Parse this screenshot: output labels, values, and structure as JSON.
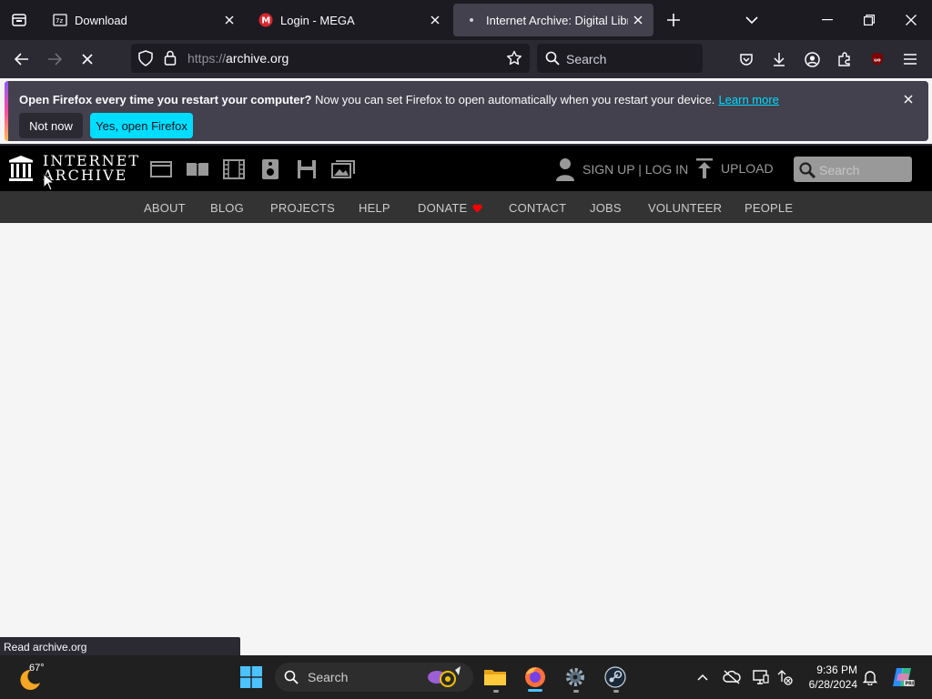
{
  "browser": {
    "tabs": [
      {
        "title": "Download",
        "active": false,
        "favicon": "download-page-icon"
      },
      {
        "title": "Login - MEGA",
        "active": false,
        "favicon": "mega-icon"
      },
      {
        "title": "Internet Archive: Digital Library",
        "active": true,
        "favicon": "loading-dot-icon"
      }
    ],
    "url_protocol": "https://",
    "url_host": "archive.org",
    "search_placeholder": "Search"
  },
  "notification": {
    "bold": "Open Firefox every time you restart your computer?",
    "text": " Now you can set Firefox to open automatically when you restart your device.",
    "link": "Learn more",
    "not_now": "Not now",
    "yes": "Yes, open Firefox"
  },
  "archive": {
    "logo_line1": "INTERNET",
    "logo_line2": "ARCHIVE",
    "media_icons": [
      "web-icon",
      "texts-icon",
      "video-icon",
      "audio-icon",
      "software-icon",
      "images-icon"
    ],
    "sign_in": "SIGN UP | LOG IN",
    "upload": "UPLOAD",
    "search_placeholder": "Search",
    "menu": [
      "ABOUT",
      "BLOG",
      "PROJECTS",
      "HELP",
      "DONATE",
      "CONTACT",
      "JOBS",
      "VOLUNTEER",
      "PEOPLE"
    ]
  },
  "status_text": "Read archive.org",
  "taskbar": {
    "temperature": "67°",
    "search_placeholder": "Search",
    "time": "9:36 PM",
    "date": "6/28/2024"
  },
  "colors": {
    "firefox_accent": "#00ddff",
    "archive_header": "#000000",
    "archive_menu": "#333333",
    "heart": "#ff0000"
  }
}
